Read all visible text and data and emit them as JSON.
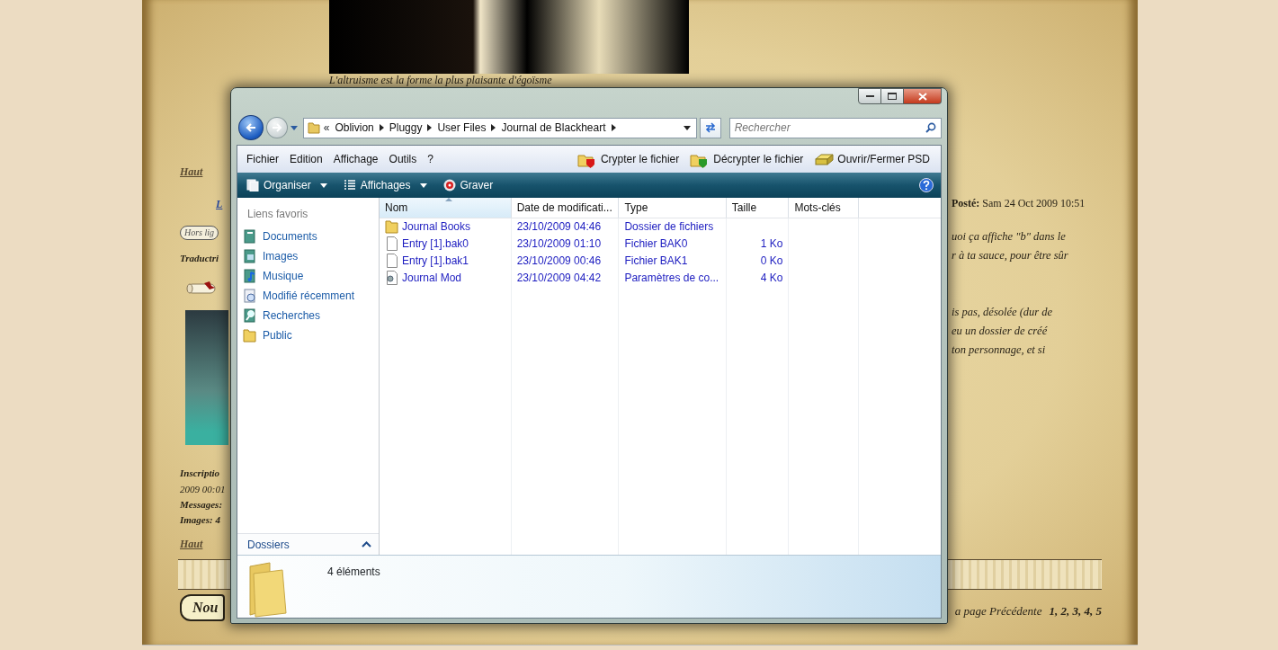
{
  "forum": {
    "motto": "L'altruisme est la forme la plus plaisante d'égoïsme",
    "left": {
      "top_link": "Haut",
      "user_link": "L",
      "status_badge": "Hors lig",
      "rank": "Traductri",
      "profile_lines": [
        "Inscriptio",
        "2009 00:01",
        "Messages:",
        "Images: 4"
      ],
      "bottom_link": "Haut",
      "scroll_button": "Nou"
    },
    "right": {
      "posted": "**Posté:** Sam 24 Oct 2009 10:51",
      "paragraphs": [
        [
          "uoi ça affiche \"b\" dans le",
          "r à ta sauce, pour être sûr"
        ],
        [
          "is pas, désolée (dur de",
          "eu un dossier de créé",
          "ton personnage, et si"
        ]
      ],
      "pagination_label": "a page Précédente",
      "pages": "1, 2, 3, 4, 5"
    }
  },
  "explorer": {
    "nav": {
      "back_disabled": false,
      "forward_disabled": true
    },
    "overflow": "«",
    "breadcrumb": [
      "Oblivion",
      "Pluggy",
      "User Files",
      "Journal de Blackheart"
    ],
    "search": {
      "placeholder": "Rechercher"
    },
    "menu": [
      "Fichier",
      "Edition",
      "Affichage",
      "Outils",
      "?"
    ],
    "actions": [
      {
        "label": "Crypter le fichier",
        "kind": "encrypt"
      },
      {
        "label": "Décrypter le fichier",
        "kind": "decrypt"
      },
      {
        "label": "Ouvrir/Fermer PSD",
        "kind": "drive"
      }
    ],
    "toolbar": [
      {
        "label": "Organiser",
        "kind": "organize",
        "dropdown": true
      },
      {
        "label": "Affichages",
        "kind": "views",
        "dropdown": true
      },
      {
        "label": "Graver",
        "kind": "burn",
        "dropdown": false
      }
    ],
    "favorites_title": "Liens favoris",
    "favorites": [
      {
        "label": "Documents",
        "kind": "documents"
      },
      {
        "label": "Images",
        "kind": "images"
      },
      {
        "label": "Musique",
        "kind": "music"
      },
      {
        "label": "Modifié récemment",
        "kind": "recent"
      },
      {
        "label": "Recherches",
        "kind": "searches"
      },
      {
        "label": "Public",
        "kind": "folder"
      }
    ],
    "folders_label": "Dossiers",
    "columns": [
      {
        "label": "Nom",
        "selected": true
      },
      {
        "label": "Date de modificati...",
        "selected": false
      },
      {
        "label": "Type",
        "selected": false
      },
      {
        "label": "Taille",
        "selected": false
      },
      {
        "label": "Mots-clés",
        "selected": false
      }
    ],
    "files": [
      {
        "kind": "folder",
        "name": "Journal Books",
        "date": "23/10/2009 04:46",
        "type": "Dossier de fichiers"
      },
      {
        "kind": "file",
        "name": "Entry [1].bak0",
        "date": "23/10/2009 01:10",
        "type": "Fichier BAK0",
        "size": "1 Ko"
      },
      {
        "kind": "file",
        "name": "Entry [1].bak1",
        "date": "23/10/2009 00:46",
        "type": "Fichier BAK1",
        "size": "0 Ko"
      },
      {
        "kind": "settings",
        "name": "Journal Mod",
        "date": "23/10/2009 04:42",
        "type": "Paramètres de co...",
        "size": "4 Ko"
      }
    ],
    "status": "4 éléments"
  }
}
